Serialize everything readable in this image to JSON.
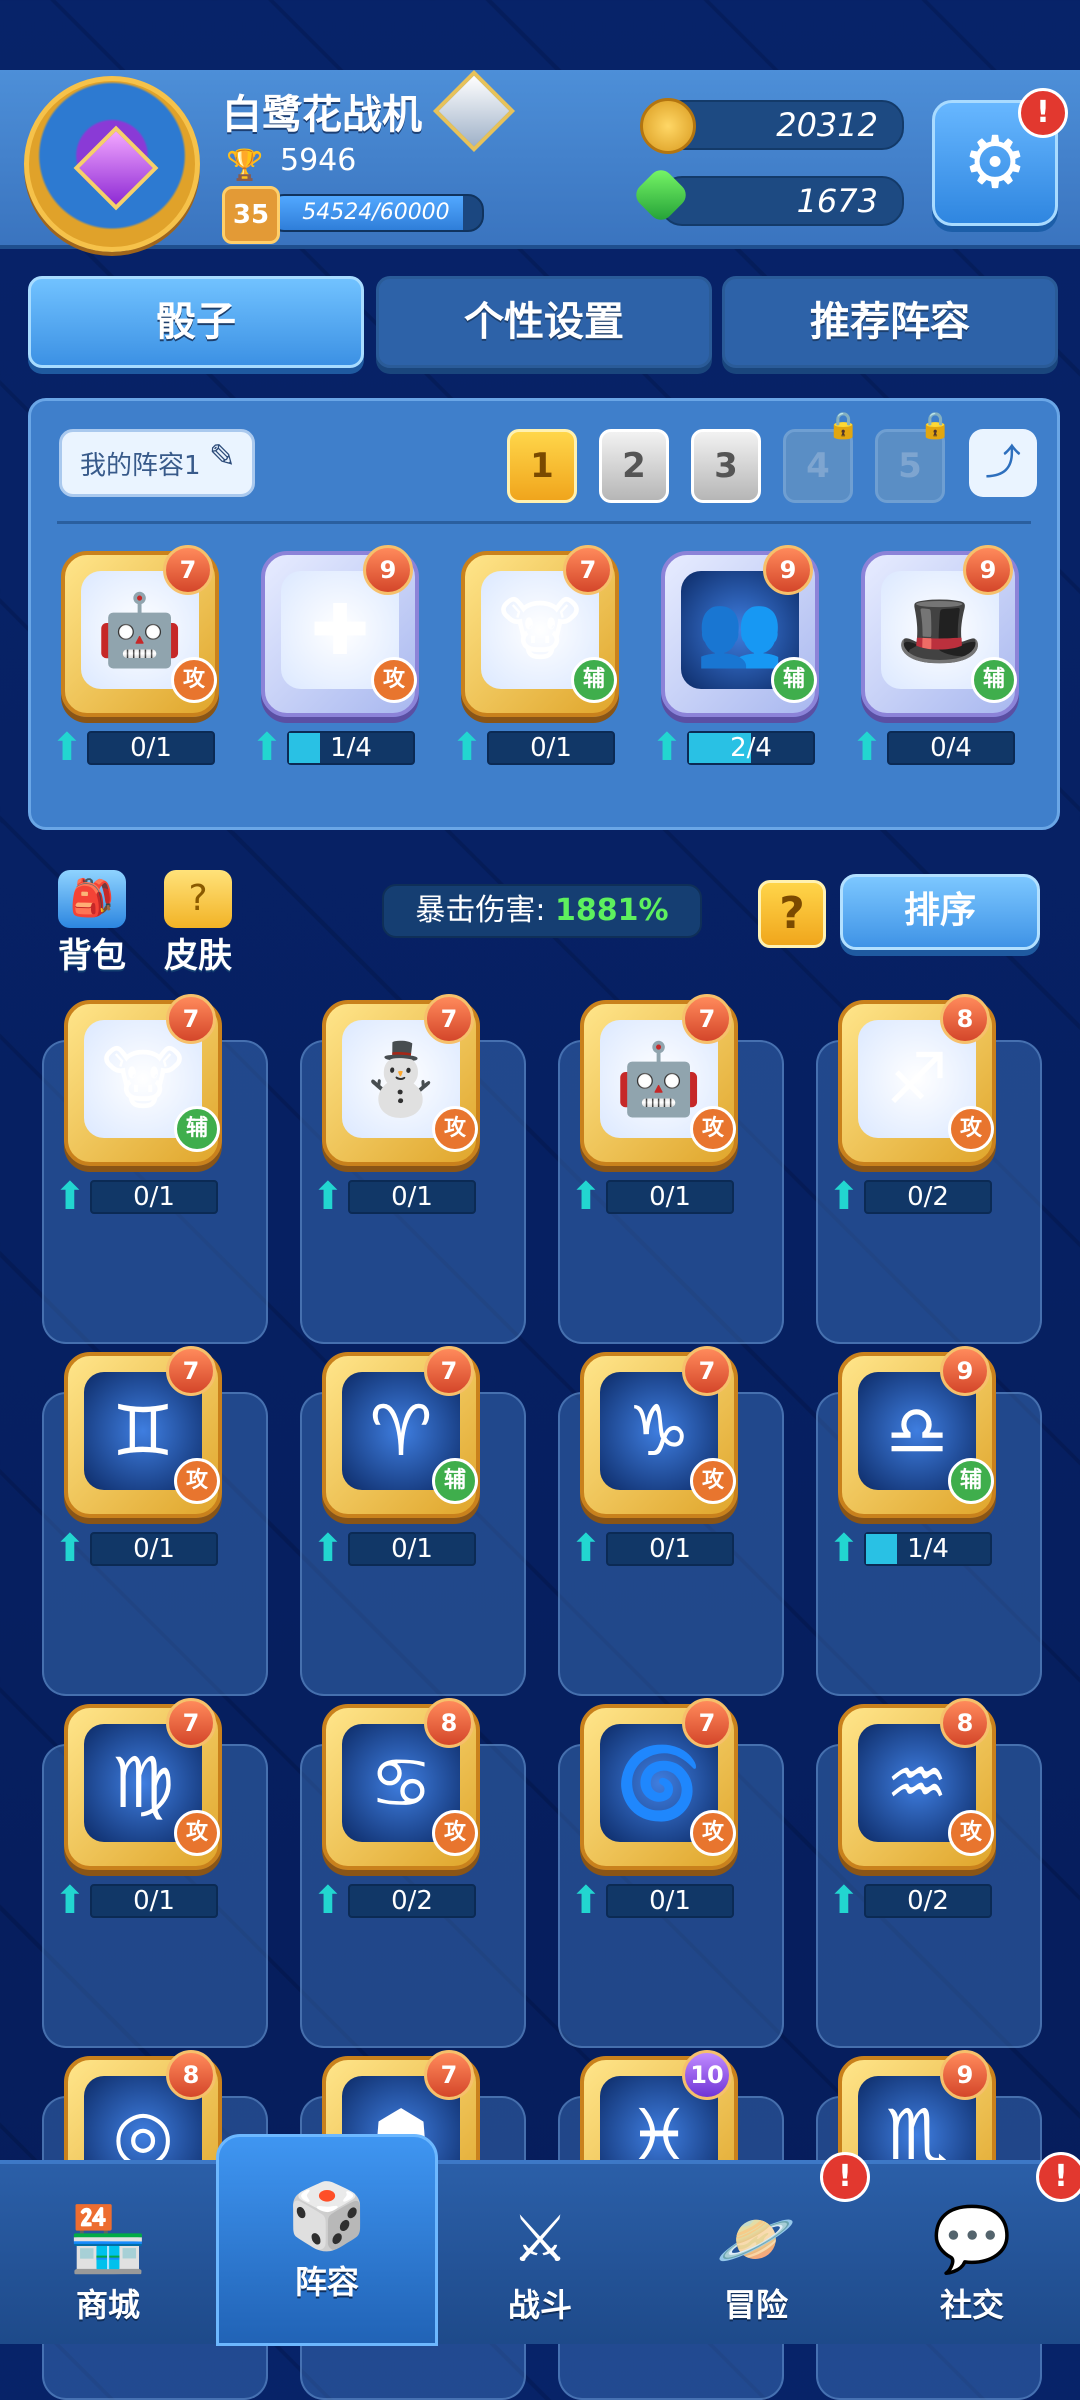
{
  "header": {
    "player_name": "白鹭花战机",
    "trophies": "5946",
    "level": "35",
    "xp_text": "54524/60000",
    "xp_fraction": 0.909,
    "gold": "20312",
    "gems": "1673",
    "alert": "!"
  },
  "tabs": [
    {
      "label": "骰子"
    },
    {
      "label": "个性设置"
    },
    {
      "label": "推荐阵容"
    }
  ],
  "deck": {
    "name": "我的阵容1",
    "slots": [
      "1",
      "2",
      "3",
      "4",
      "5"
    ],
    "active_slot": "1",
    "dice": [
      {
        "icon": "robot-icon",
        "level": "7",
        "role": "攻",
        "progress": "0/1",
        "fill": 0.0
      },
      {
        "icon": "ice-cross-icon",
        "level": "9",
        "role": "攻",
        "progress": "1/4",
        "fill": 0.25
      },
      {
        "icon": "fire-bull-icon",
        "level": "7",
        "role": "辅",
        "progress": "0/1",
        "fill": 0.0
      },
      {
        "icon": "twins-silhouette-icon",
        "level": "9",
        "role": "辅",
        "progress": "2/4",
        "fill": 0.5
      },
      {
        "icon": "red-hat-icon",
        "level": "9",
        "role": "辅",
        "progress": "0/4",
        "fill": 0.0
      }
    ]
  },
  "toolbar": {
    "backpack_label": "背包",
    "skin_label": "皮肤",
    "crit_label": "暴击伤害:",
    "crit_value": "1881%",
    "help_label": "?",
    "sort_label": "排序"
  },
  "collection": [
    {
      "icon": "fire-bull-icon",
      "level": "7",
      "role": "辅",
      "progress": "0/1",
      "fill": 0.0
    },
    {
      "icon": "snowman-icon",
      "level": "7",
      "role": "攻",
      "progress": "0/1",
      "fill": 0.0
    },
    {
      "icon": "robot-icon",
      "level": "7",
      "role": "攻",
      "progress": "0/1",
      "fill": 0.0
    },
    {
      "icon": "sagittarius-icon",
      "level": "8",
      "role": "攻",
      "progress": "0/2",
      "fill": 0.0
    },
    {
      "icon": "gemini-icon",
      "level": "7",
      "role": "攻",
      "progress": "0/1",
      "fill": 0.0
    },
    {
      "icon": "aries-icon",
      "level": "7",
      "role": "辅",
      "progress": "0/1",
      "fill": 0.0
    },
    {
      "icon": "capricorn-icon",
      "level": "7",
      "role": "攻",
      "progress": "0/1",
      "fill": 0.0
    },
    {
      "icon": "libra-icon",
      "level": "9",
      "role": "辅",
      "progress": "1/4",
      "fill": 0.25
    },
    {
      "icon": "virgo-icon",
      "level": "7",
      "role": "攻",
      "progress": "0/1",
      "fill": 0.0
    },
    {
      "icon": "cancer-icon",
      "level": "8",
      "role": "攻",
      "progress": "0/2",
      "fill": 0.0
    },
    {
      "icon": "whirl-icon",
      "level": "7",
      "role": "攻",
      "progress": "0/1",
      "fill": 0.0
    },
    {
      "icon": "aquarius-icon",
      "level": "8",
      "role": "攻",
      "progress": "0/2",
      "fill": 0.0
    },
    {
      "icon": "spiral-icon",
      "level": "8"
    },
    {
      "icon": "red-mask-icon",
      "level": "7"
    },
    {
      "icon": "pisces-icon",
      "level": "10"
    },
    {
      "icon": "scorpio-icon",
      "level": "9"
    }
  ],
  "nav": [
    {
      "label": "商城",
      "icon": "shop-icon"
    },
    {
      "label": "阵容",
      "icon": "dice-icon"
    },
    {
      "label": "战斗",
      "icon": "crossed-swords-icon"
    },
    {
      "label": "冒险",
      "icon": "planet-icon"
    },
    {
      "label": "社交",
      "icon": "chat-icon"
    }
  ]
}
